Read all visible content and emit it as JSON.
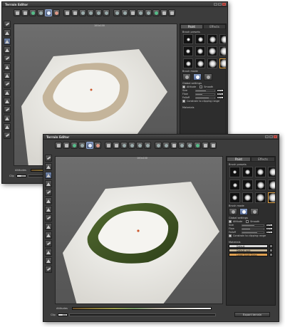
{
  "window_top": {
    "title": "Terrain Editor"
  },
  "window_bottom": {
    "title": "Terrain Editor"
  },
  "toolbar": {
    "zoom_label": "Altitudes"
  },
  "viewport": {
    "coord_label_top": "100x100",
    "coord_label_bottom": "100x100"
  },
  "panel": {
    "tabs": [
      "Paint",
      "Effects"
    ],
    "brush_presets_title": "Brush presets",
    "brush_mode_title": "Brush mode",
    "global_settings_title": "Global settings",
    "altitude_label": "Altitude",
    "smooth_label": "Smooth",
    "sliders": [
      {
        "label": "Size",
        "value": 0.55,
        "display": "50%"
      },
      {
        "label": "Flow",
        "value": 0.35,
        "display": "30%"
      },
      {
        "label": "Falloff",
        "value": 0.7,
        "display": "80%"
      }
    ],
    "constrain_label": "Constrain to clipping range",
    "materials_title": "Materials",
    "materials": [
      {
        "name": "Default",
        "color": "#d8d8d8"
      },
      {
        "name": "Default rock",
        "color": "#c8b89a"
      },
      {
        "name": "Large Scale Grass",
        "color": "#e0a050"
      }
    ]
  },
  "bottom": {
    "altitudes_label": "Altitudes",
    "clip_label": "Clip",
    "clip_value": "100",
    "export_label": "Export terrain"
  },
  "colors": {
    "window_bg": "#3c3c3c",
    "viewport_bg": "#666666",
    "terrain": "#eeeeea",
    "rock": "#c4b49a",
    "grass": "#3e5424",
    "selection": "#e0a040"
  }
}
